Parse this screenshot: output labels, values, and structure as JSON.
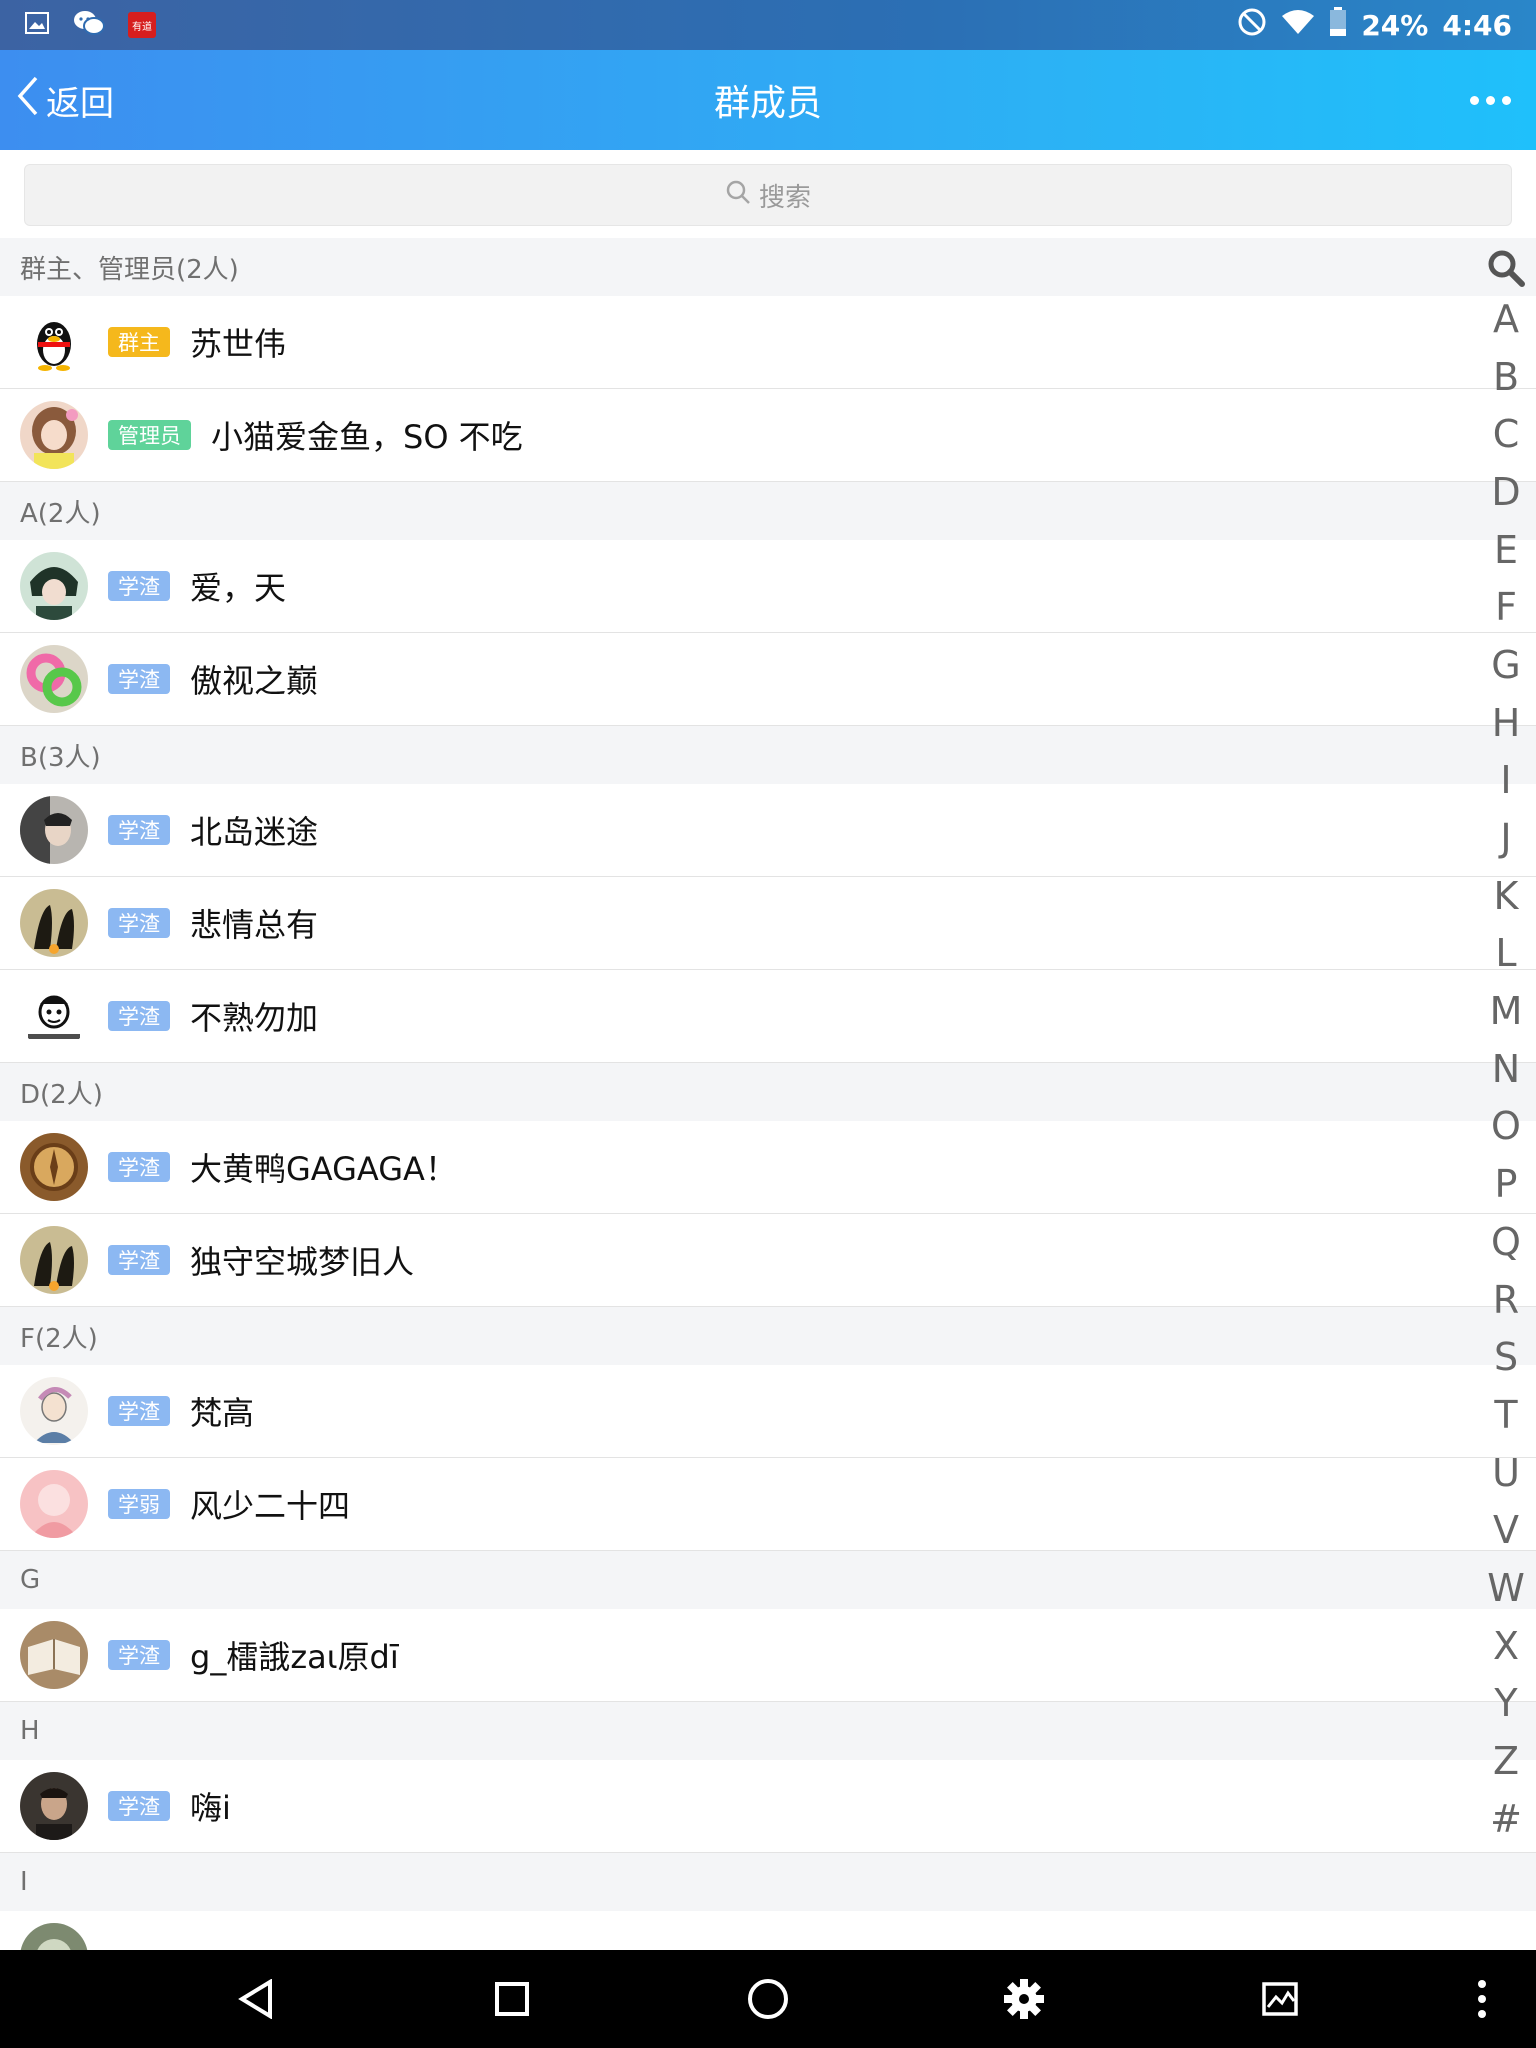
{
  "status_bar": {
    "battery": "24%",
    "time": "4:46",
    "app_icon_text": "有道"
  },
  "nav": {
    "back_label": "返回",
    "title": "群成员"
  },
  "search": {
    "placeholder": "搜索"
  },
  "badge_colors": {
    "群主": "#f5b81c",
    "管理员": "#5fd39a",
    "学渣": "#8cb8f2",
    "学弱": "#8cb8f2"
  },
  "list": [
    {
      "type": "section",
      "title": "群主、管理员(2人)"
    },
    {
      "type": "member",
      "badge": "群主",
      "name": "苏世伟",
      "avatar": "penguin-avatar"
    },
    {
      "type": "member",
      "badge": "管理员",
      "name": "小猫爱金鱼，SO 不吃",
      "avatar": "girl-avatar"
    },
    {
      "type": "section",
      "title": "A(2人)"
    },
    {
      "type": "member",
      "badge": "学渣",
      "name": "爱，天",
      "avatar": "anime-avatar"
    },
    {
      "type": "member",
      "badge": "学渣",
      "name": "傲视之巅",
      "avatar": "rings-avatar"
    },
    {
      "type": "section",
      "title": "B(3人)"
    },
    {
      "type": "member",
      "badge": "学渣",
      "name": "北岛迷途",
      "avatar": "portrait-avatar"
    },
    {
      "type": "member",
      "badge": "学渣",
      "name": "悲情总有",
      "avatar": "birds-avatar"
    },
    {
      "type": "member",
      "badge": "学渣",
      "name": "不熟勿加",
      "avatar": "meme-avatar"
    },
    {
      "type": "section",
      "title": "D(2人)"
    },
    {
      "type": "member",
      "badge": "学渣",
      "name": "大黄鸭GAGAGA！",
      "avatar": "compass-avatar"
    },
    {
      "type": "member",
      "badge": "学渣",
      "name": "独守空城梦旧人",
      "avatar": "birds-avatar"
    },
    {
      "type": "section",
      "title": "F(2人)"
    },
    {
      "type": "member",
      "badge": "学渣",
      "name": "梵高",
      "avatar": "sketch-avatar"
    },
    {
      "type": "member",
      "badge": "学弱",
      "name": "风少二十四",
      "avatar": "pink-avatar"
    },
    {
      "type": "section",
      "title": "G"
    },
    {
      "type": "member",
      "badge": "学渣",
      "name": "g_檑誐zaι原dī",
      "avatar": "book-avatar"
    },
    {
      "type": "section",
      "title": "H"
    },
    {
      "type": "member",
      "badge": "学渣",
      "name": "嗨i",
      "avatar": "man-avatar"
    },
    {
      "type": "section",
      "title": "I"
    },
    {
      "type": "member",
      "badge": "",
      "name": "",
      "avatar": "partial-avatar"
    }
  ],
  "index_letters": [
    "A",
    "B",
    "C",
    "D",
    "E",
    "F",
    "G",
    "H",
    "I",
    "J",
    "K",
    "L",
    "M",
    "N",
    "O",
    "P",
    "Q",
    "R",
    "S",
    "T",
    "U",
    "V",
    "W",
    "X",
    "Y",
    "Z",
    "#"
  ]
}
